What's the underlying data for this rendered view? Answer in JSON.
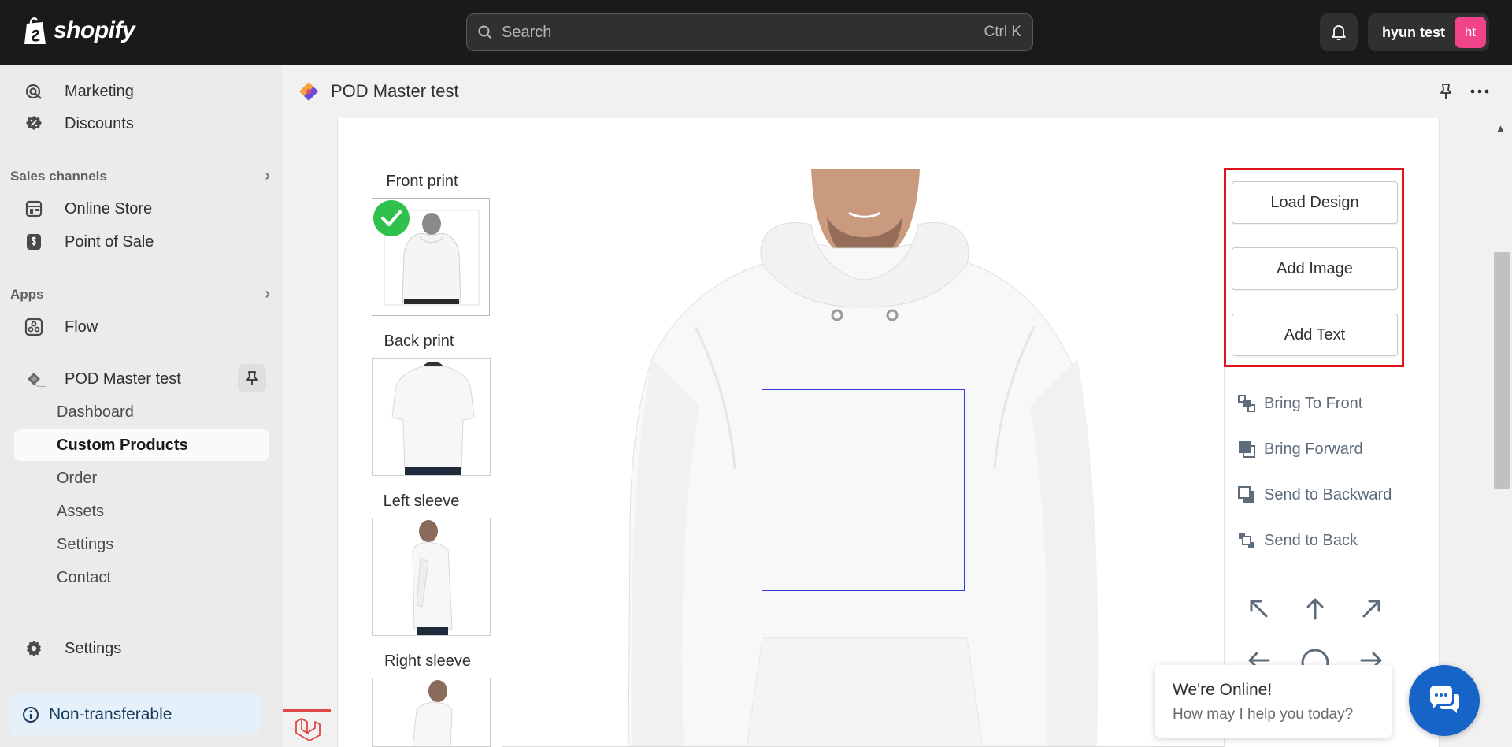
{
  "topbar": {
    "logo_text": "shopify",
    "search_placeholder": "Search",
    "search_shortcut": "Ctrl K",
    "user_name": "hyun test",
    "user_initials": "ht"
  },
  "sidebar": {
    "items": [
      {
        "label": "Marketing"
      },
      {
        "label": "Discounts"
      }
    ],
    "sales_channels": {
      "title": "Sales channels",
      "items": [
        {
          "label": "Online Store"
        },
        {
          "label": "Point of Sale"
        }
      ]
    },
    "apps": {
      "title": "Apps",
      "items": [
        {
          "label": "Flow"
        }
      ]
    },
    "app": {
      "label": "POD Master test",
      "subitems": [
        {
          "label": "Dashboard"
        },
        {
          "label": "Custom Products"
        },
        {
          "label": "Order"
        },
        {
          "label": "Assets"
        },
        {
          "label": "Settings"
        },
        {
          "label": "Contact"
        }
      ]
    },
    "settings_label": "Settings",
    "non_transferable_label": "Non-transferable"
  },
  "header": {
    "title": "POD Master test"
  },
  "editor": {
    "views": [
      {
        "label": "Front print"
      },
      {
        "label": "Back print"
      },
      {
        "label": "Left sleeve"
      },
      {
        "label": "Right sleeve"
      }
    ],
    "buttons": {
      "load_design": "Load Design",
      "add_image": "Add Image",
      "add_text": "Add Text"
    },
    "layer_actions": [
      {
        "label": "Bring To Front"
      },
      {
        "label": "Bring Forward"
      },
      {
        "label": "Send to Backward"
      },
      {
        "label": "Send to Back"
      }
    ]
  },
  "chat": {
    "title": "We're Online!",
    "subtitle": "How may I help you today?"
  },
  "colors": {
    "topbar": "#1a1a1a",
    "highlight": "#e0121b",
    "print_area": "#2f3bd6",
    "check": "#2fc14c",
    "chat": "#1764c9",
    "avatar": "#f0438a"
  }
}
